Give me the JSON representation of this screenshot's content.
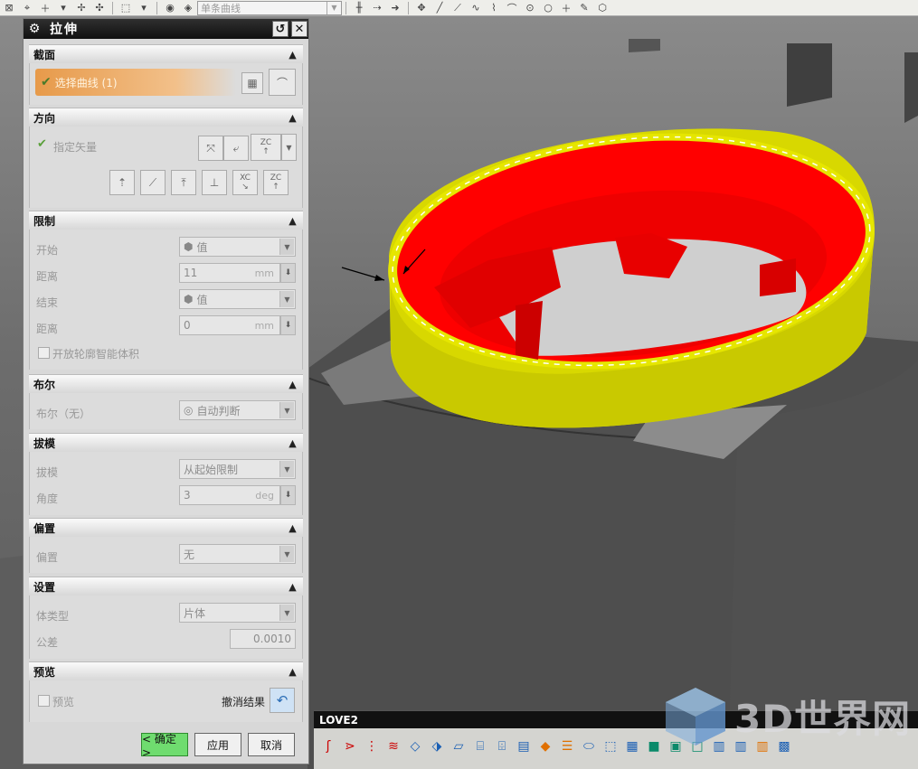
{
  "toolbar": {
    "curve_filter": "单条曲线"
  },
  "dialog": {
    "title": "拉伸",
    "sections": {
      "section": {
        "title": "截面",
        "select_curve": "选择曲线 (1)"
      },
      "direction": {
        "title": "方向",
        "specify_vector": "指定矢量",
        "zc_label": "ZC",
        "xc_label": "XC"
      },
      "limits": {
        "title": "限制",
        "start_label": "开始",
        "start_value": "值",
        "distance1_label": "距离",
        "distance1_value": "11",
        "distance1_unit": "mm",
        "end_label": "结束",
        "end_value": "值",
        "distance2_label": "距离",
        "distance2_value": "0",
        "distance2_unit": "mm",
        "open_profile_label": "开放轮廓智能体积"
      },
      "boolean": {
        "title": "布尔",
        "label": "布尔（无）",
        "value": "自动判断"
      },
      "draft": {
        "title": "拔模",
        "draft_label": "拔模",
        "draft_value": "从起始限制",
        "angle_label": "角度",
        "angle_value": "3",
        "angle_unit": "deg"
      },
      "offset": {
        "title": "偏置",
        "label": "偏置",
        "value": "无"
      },
      "settings": {
        "title": "设置",
        "body_type_label": "体类型",
        "body_type_value": "片体",
        "tolerance_label": "公差",
        "tolerance_value": "0.0010"
      },
      "preview": {
        "title": "预览",
        "preview_label": "预览",
        "undo_label": "撤消结果"
      }
    },
    "buttons": {
      "ok": "< 确定 >",
      "apply": "应用",
      "cancel": "取消"
    }
  },
  "bottom_panel": {
    "title": "LOVE2"
  },
  "watermark": {
    "text": "3D世界网"
  },
  "colors": {
    "model_red": "#ff0000",
    "model_yellow": "#d8d800",
    "ok_green": "#6fdc6f",
    "selection_orange": "#f0a050"
  }
}
